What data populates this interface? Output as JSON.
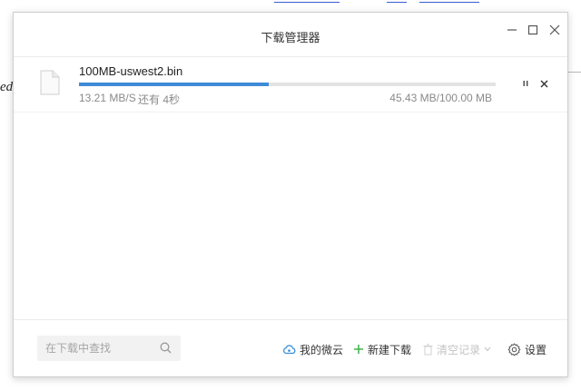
{
  "window": {
    "title": "下载管理器"
  },
  "background": {
    "partial_text": "ed"
  },
  "download": {
    "filename": "100MB-uswest2.bin",
    "speed": "13.21 MB/S",
    "time_remaining": "还有 4秒",
    "size_progress": "45.43 MB/100.00 MB",
    "progress_fraction": 0.4543
  },
  "footer": {
    "search_placeholder": "在下载中查找",
    "weiyun_label": "我的微云",
    "new_download_label": "新建下载",
    "clear_records_label": "清空记录",
    "settings_label": "设置"
  },
  "icons": {
    "minimize": "minimize-icon",
    "maximize": "maximize-icon",
    "close": "close-icon",
    "file": "file-icon",
    "pause": "pause-icon",
    "cancel": "cancel-icon",
    "search": "search-icon",
    "cloud": "cloud-icon",
    "plus": "plus-icon",
    "trash": "trash-icon",
    "chevron": "chevron-down-icon",
    "gear": "gear-icon"
  },
  "colors": {
    "progress_fill": "#3d8bd7",
    "progress_track": "#e3e3e3",
    "plus_icon": "#3db34a",
    "cloud_icon": "#3a8ed6"
  }
}
